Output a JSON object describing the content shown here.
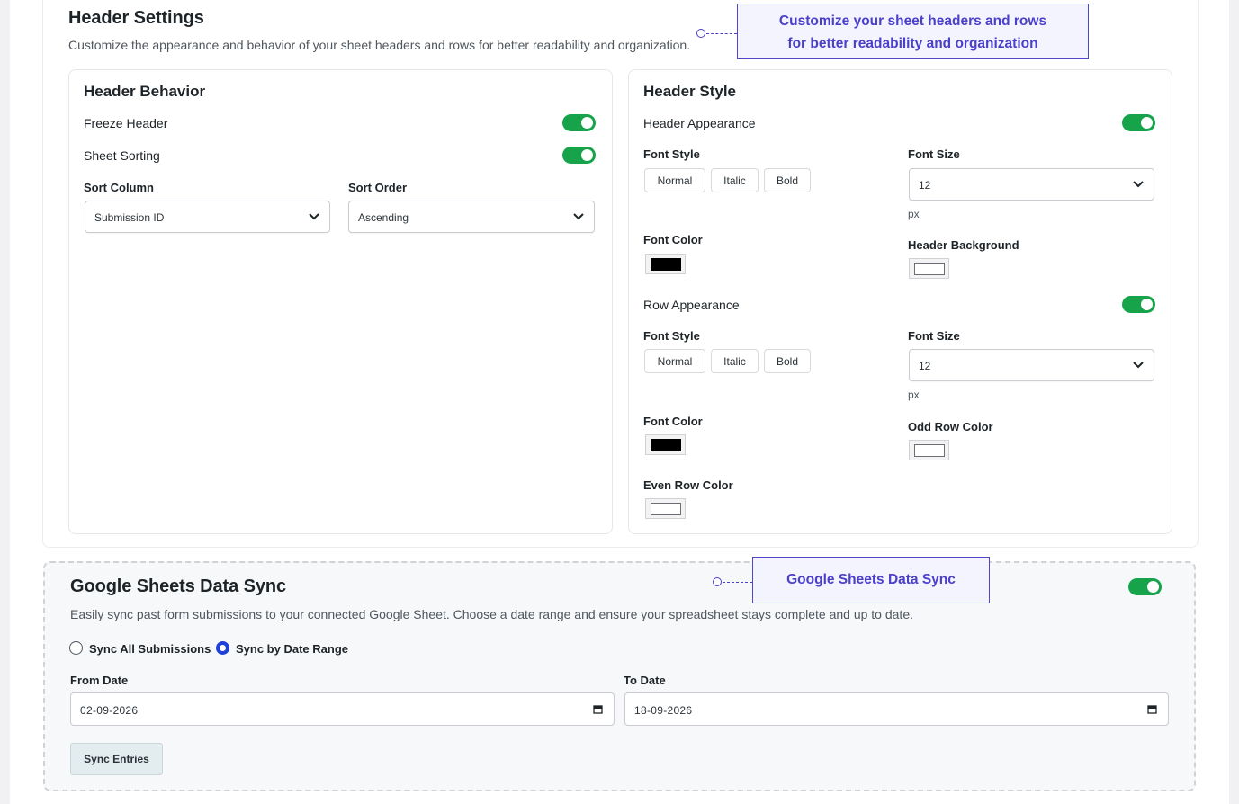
{
  "header_settings": {
    "title": "Header Settings",
    "description": "Customize the appearance and behavior of your sheet headers and rows for better readability and organization.",
    "callout_line1": "Customize your sheet headers and rows",
    "callout_line2": "for better readability and organization"
  },
  "header_behavior": {
    "title": "Header Behavior",
    "freeze_header_label": "Freeze Header",
    "freeze_header_on": true,
    "sheet_sorting_label": "Sheet Sorting",
    "sheet_sorting_on": true,
    "sort_column_label": "Sort Column",
    "sort_column_value": "Submission ID",
    "sort_order_label": "Sort Order",
    "sort_order_value": "Ascending"
  },
  "header_style": {
    "title": "Header Style",
    "header_appearance_label": "Header Appearance",
    "header_appearance_on": true,
    "font_style_label": "Font Style",
    "font_style_options": [
      "Normal",
      "Italic",
      "Bold"
    ],
    "font_size_label": "Font Size",
    "font_size_value": "12",
    "font_size_unit": "px",
    "font_color_label": "Font Color",
    "font_color": "#000000",
    "header_background_label": "Header Background",
    "header_background": "#ffffff",
    "row_appearance_label": "Row Appearance",
    "row_appearance_on": true,
    "row_font_style_label": "Font Style",
    "row_font_style_options": [
      "Normal",
      "Italic",
      "Bold"
    ],
    "row_font_size_label": "Font Size",
    "row_font_size_value": "12",
    "row_font_size_unit": "px",
    "row_font_color_label": "Font Color",
    "row_font_color": "#000000",
    "odd_row_color_label": "Odd Row Color",
    "odd_row_color": "#ffffff",
    "even_row_color_label": "Even Row Color",
    "even_row_color": "#ffffff"
  },
  "data_sync": {
    "title": "Google Sheets Data Sync",
    "callout": "Google Sheets Data Sync",
    "enabled": true,
    "description": "Easily sync past form submissions to your connected Google Sheet. Choose a date range and ensure your spreadsheet stays complete and up to date.",
    "option_all": "Sync All Submissions",
    "option_range": "Sync by Date Range",
    "selected": "Sync by Date Range",
    "from_label": "From Date",
    "from_value": "02-09-2026",
    "to_label": "To Date",
    "to_value": "18-09-2026",
    "sync_button": "Sync Entries"
  },
  "colors": {
    "toggle_on": "#16a34a",
    "accent": "#4a40c9",
    "radio_selected": "#1e3fd8"
  }
}
